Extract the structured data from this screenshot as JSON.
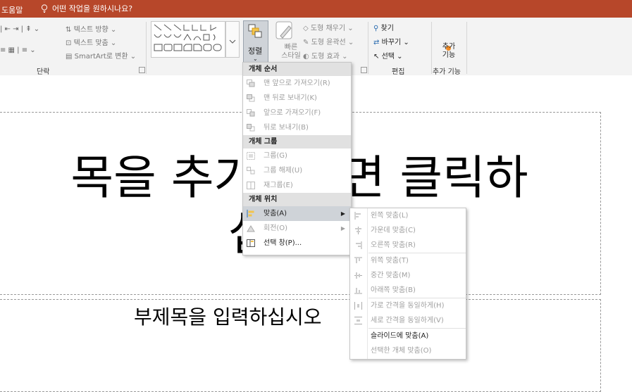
{
  "titlebar": {
    "help_tab": "도움말",
    "tell_me": "어떤 작업을 원하시나요?",
    "color": "#b7472a"
  },
  "ribbon": {
    "paragraph": {
      "text_direction": "텍스트 방향",
      "text_align": "텍스트 맞춤",
      "smartart": "SmartArt로 변환",
      "label": "단락"
    },
    "drawing": {
      "arrange_label": "정렬",
      "quick_styles": "빠른 스타일",
      "shape_fill": "도형 채우기",
      "shape_outline": "도형 윤곽선",
      "shape_effects": "도형 효과"
    },
    "editing": {
      "find": "찾기",
      "replace": "바꾸기",
      "select": "선택",
      "label": "편집"
    },
    "addins": {
      "button": "추가 기능",
      "label": "추가 기능"
    }
  },
  "slide": {
    "title_line1": "목을 추가하려면 클릭하",
    "title_line2": "십시오.",
    "subtitle": "부제목을 입력하십시오"
  },
  "arrange_menu": {
    "sections": [
      {
        "header": "개체 순서",
        "items": [
          {
            "label": "맨 앞으로 가져오기(R)",
            "icon": "bring-to-front-icon",
            "enabled": false
          },
          {
            "label": "맨 뒤로 보내기(K)",
            "icon": "send-to-back-icon",
            "enabled": false
          },
          {
            "label": "앞으로 가져오기(F)",
            "icon": "bring-forward-icon",
            "enabled": false
          },
          {
            "label": "뒤로 보내기(B)",
            "icon": "send-backward-icon",
            "enabled": false
          }
        ]
      },
      {
        "header": "개체 그룹",
        "items": [
          {
            "label": "그룹(G)",
            "icon": "group-icon",
            "enabled": false
          },
          {
            "label": "그룹 해제(U)",
            "icon": "ungroup-icon",
            "enabled": false
          },
          {
            "label": "재그룹(E)",
            "icon": "regroup-icon",
            "enabled": false
          }
        ]
      },
      {
        "header": "개체 위치",
        "items": [
          {
            "label": "맞춤(A)",
            "icon": "align-icon",
            "enabled": true,
            "submenu": true,
            "highlighted": true
          },
          {
            "label": "회전(O)",
            "icon": "rotate-icon",
            "enabled": false,
            "submenu": true
          },
          {
            "label": "선택 창(P)...",
            "icon": "selection-pane-icon",
            "enabled": true
          }
        ]
      }
    ]
  },
  "align_submenu": {
    "items": [
      {
        "label": "왼쪽 맞춤(L)",
        "icon": "align-left-icon",
        "enabled": false
      },
      {
        "label": "가운데 맞춤(C)",
        "icon": "align-center-icon",
        "enabled": false
      },
      {
        "label": "오른쪽 맞춤(R)",
        "icon": "align-right-icon",
        "enabled": false
      },
      {
        "label": "위쪽 맞춤(T)",
        "icon": "align-top-icon",
        "enabled": false
      },
      {
        "label": "중간 맞춤(M)",
        "icon": "align-middle-icon",
        "enabled": false
      },
      {
        "label": "아래쪽 맞춤(B)",
        "icon": "align-bottom-icon",
        "enabled": false
      },
      {
        "label": "가로 간격을 동일하게(H)",
        "icon": "distribute-horizontal-icon",
        "enabled": false
      },
      {
        "label": "세로 간격을 동일하게(V)",
        "icon": "distribute-vertical-icon",
        "enabled": false
      },
      {
        "label": "슬라이드에 맞춤(A)",
        "icon": "align-to-slide-icon",
        "enabled": true
      },
      {
        "label": "선택한 개체 맞춤(O)",
        "icon": "align-selected-icon",
        "enabled": false
      }
    ]
  }
}
